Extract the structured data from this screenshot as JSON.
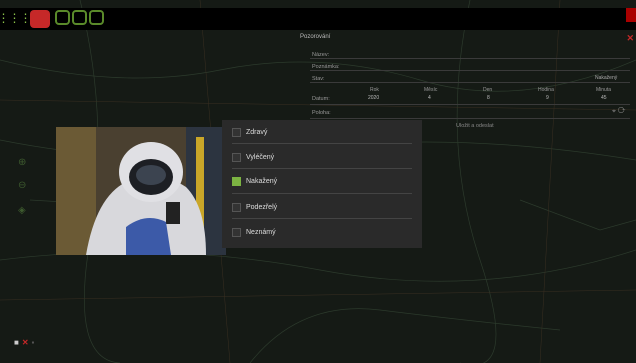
{
  "dialog": {
    "title": "Pozorování",
    "labels": {
      "name": "Název:",
      "note": "Poznámka:",
      "state": "Stav:",
      "date": "Datum:",
      "position": "Poloha:"
    },
    "state_value": "Nakažený",
    "date_columns": [
      {
        "header": "Rok",
        "value": "2020"
      },
      {
        "header": "Měsíc",
        "value": "4"
      },
      {
        "header": "Den",
        "value": "8"
      },
      {
        "header": "Hodina",
        "value": "9"
      },
      {
        "header": "Minuta",
        "value": "45"
      }
    ],
    "save_label": "Uložit a odeslat"
  },
  "state_options": [
    {
      "label": "Zdravý",
      "checked": false
    },
    {
      "label": "Vyléčený",
      "checked": false
    },
    {
      "label": "Nakažený",
      "checked": true
    },
    {
      "label": "Podezřelý",
      "checked": false
    },
    {
      "label": "Neznámý",
      "checked": false
    }
  ],
  "colors": {
    "accent": "#7cb342",
    "danger": "#c62828"
  },
  "icons": [
    "grid-icon",
    "virus-icon",
    "stop-icon",
    "add-icon",
    "chat-icon",
    "close-icon",
    "zoom-in-icon",
    "zoom-out-icon",
    "folder-icon",
    "delete-icon"
  ]
}
